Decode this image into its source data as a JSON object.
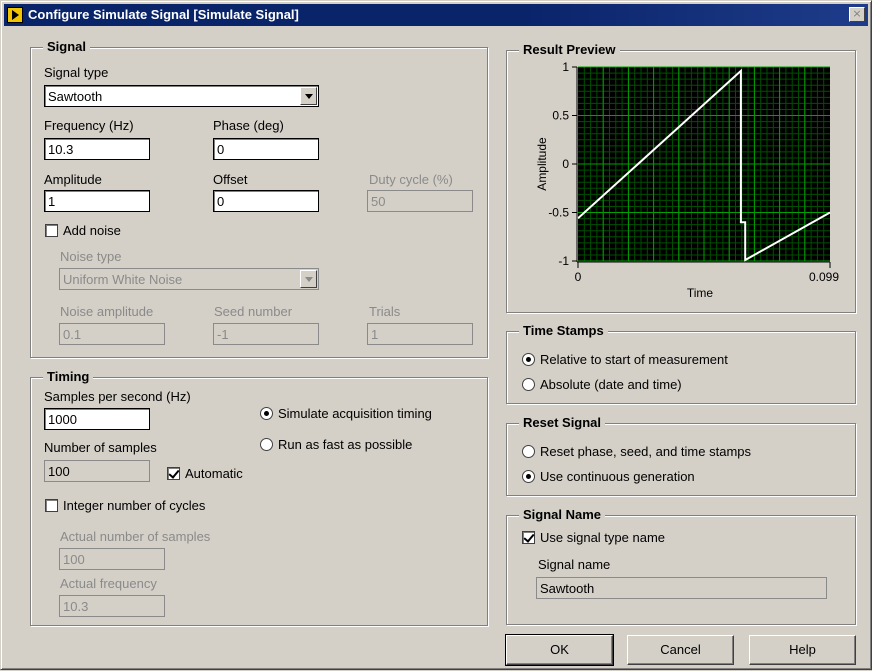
{
  "window": {
    "title": "Configure Simulate Signal [Simulate Signal]",
    "close_glyph": "×"
  },
  "signal": {
    "legend": "Signal",
    "signal_type_label": "Signal type",
    "signal_type_value": "Sawtooth",
    "frequency_label": "Frequency (Hz)",
    "frequency_value": "10.3",
    "phase_label": "Phase (deg)",
    "phase_value": "0",
    "amplitude_label": "Amplitude",
    "amplitude_value": "1",
    "offset_label": "Offset",
    "offset_value": "0",
    "duty_cycle_label": "Duty cycle (%)",
    "duty_cycle_value": "50",
    "add_noise_label": "Add noise",
    "add_noise_checked": false,
    "noise_type_label": "Noise type",
    "noise_type_value": "Uniform White Noise",
    "noise_amplitude_label": "Noise amplitude",
    "noise_amplitude_value": "0.1",
    "seed_number_label": "Seed number",
    "seed_number_value": "-1",
    "trials_label": "Trials",
    "trials_value": "1"
  },
  "timing": {
    "legend": "Timing",
    "samples_per_second_label": "Samples per second (Hz)",
    "samples_per_second_value": "1000",
    "simulate_acquisition_label": "Simulate acquisition timing",
    "run_fast_label": "Run as fast as possible",
    "number_of_samples_label": "Number of samples",
    "number_of_samples_value": "100",
    "automatic_label": "Automatic",
    "integer_cycles_label": "Integer number of cycles",
    "actual_samples_label": "Actual number of samples",
    "actual_samples_value": "100",
    "actual_frequency_label": "Actual frequency",
    "actual_frequency_value": "10.3"
  },
  "result_preview": {
    "legend": "Result Preview",
    "colors": {
      "background": "#000000",
      "grid_major": "#00a000",
      "grid_minor": "#005000",
      "trace": "#ffffff"
    }
  },
  "chart_data": {
    "type": "line",
    "title": "",
    "xlabel": "Time",
    "ylabel": "Amplitude",
    "xlim": [
      0,
      0.099
    ],
    "ylim": [
      -1,
      1
    ],
    "x_tick_labels": [
      "0",
      "0.099"
    ],
    "y_tick_labels": [
      "1",
      "0.5",
      "0",
      "-0.5",
      "-1"
    ],
    "y_ticks": [
      1,
      0.5,
      0,
      -0.5,
      -1
    ],
    "grid": true,
    "series": [
      {
        "x": [
          0,
          0.064,
          0.064,
          0.0657,
          0.0657,
          0.099
        ],
        "y": [
          -0.56,
          0.96,
          -0.6,
          -0.6,
          -0.99,
          -0.5
        ]
      }
    ]
  },
  "time_stamps": {
    "legend": "Time Stamps",
    "relative_label": "Relative to start of measurement",
    "absolute_label": "Absolute (date and time)"
  },
  "reset_signal": {
    "legend": "Reset Signal",
    "reset_phase_label": "Reset phase, seed, and time stamps",
    "continuous_label": "Use continuous generation"
  },
  "signal_name": {
    "legend": "Signal Name",
    "use_type_name_label": "Use signal type name",
    "signal_name_label": "Signal name",
    "signal_name_value": "Sawtooth"
  },
  "buttons": {
    "ok": "OK",
    "cancel": "Cancel",
    "help": "Help"
  }
}
